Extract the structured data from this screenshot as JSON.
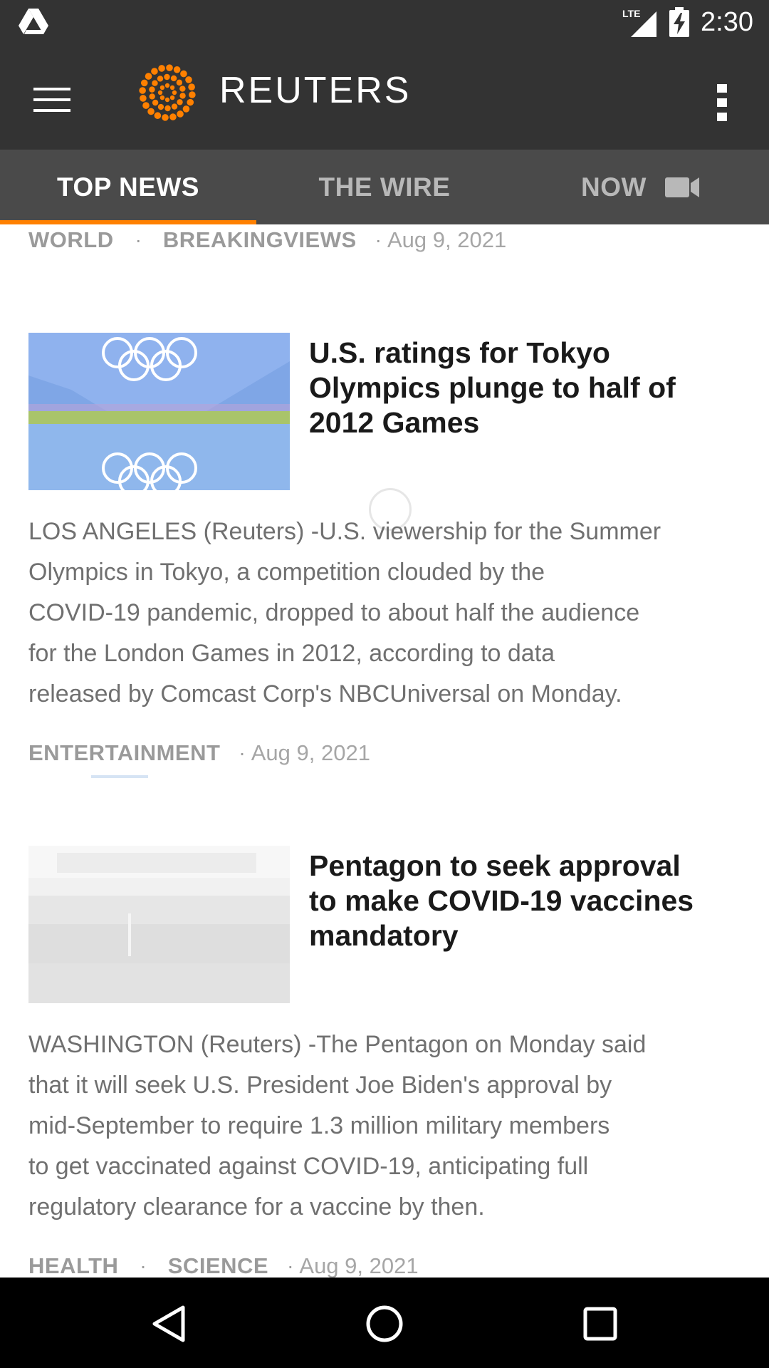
{
  "status_bar": {
    "time": "2:30",
    "network_label": "LTE",
    "icons": [
      "drive-icon",
      "signal-icon",
      "battery-charging-icon"
    ]
  },
  "app_bar": {
    "brand": "REUTERS",
    "brand_color": "#ff8000",
    "icons": [
      "menu-icon",
      "reuters-logo-icon",
      "more-vert-icon"
    ]
  },
  "tabs": [
    {
      "label": "TOP NEWS",
      "active": true
    },
    {
      "label": "THE WIRE",
      "active": false
    },
    {
      "label": "NOW",
      "active": false,
      "icon": "video-camera-icon"
    }
  ],
  "feed": {
    "top_meta": {
      "tags": [
        "WORLD",
        "BREAKINGVIEWS"
      ],
      "date": "Aug 9, 2021"
    },
    "articles": [
      {
        "headline": "U.S. ratings for Tokyo Olympics plunge to half of 2012 Games",
        "headline_lines": [
          "U.S. ratings for Tokyo",
          "Olympics plunge to half of",
          "2012 Games"
        ],
        "thumbnail": "olympic-rings-image",
        "summary_lines": [
          "LOS ANGELES (Reuters) -U.S. viewership for the Summer",
          "Olympics in Tokyo, a competition clouded by the",
          "COVID-19 pandemic, dropped to about half the audience",
          "for the London Games in 2012, according to data",
          "released by Comcast Corp's NBCUniversal on Monday."
        ],
        "tags": [
          "ENTERTAINMENT"
        ],
        "date": "Aug 9, 2021"
      },
      {
        "headline": "Pentagon to seek approval to make COVID-19 vaccines mandatory",
        "headline_lines": [
          "Pentagon to seek approval",
          "to make COVID-19 vaccines",
          "mandatory"
        ],
        "thumbnail": "pentagon-image",
        "summary_lines": [
          "WASHINGTON (Reuters) -The Pentagon on Monday said",
          "that it will seek U.S. President Joe Biden's approval by",
          "mid-September to require 1.3 million military members",
          "to get vaccinated against COVID-19, anticipating full",
          "regulatory clearance for a vaccine by then."
        ],
        "tags": [
          "HEALTH",
          "SCIENCE"
        ],
        "date": "Aug 9, 2021"
      }
    ]
  },
  "nav_bar": {
    "icons": [
      "back-icon",
      "home-icon",
      "recents-icon"
    ]
  },
  "colors": {
    "status_bar": "#333333",
    "app_bar": "#333333",
    "tab_bar": "#4a4a4a",
    "tab_indicator": "#ff8000",
    "nav_bar": "#000000"
  }
}
